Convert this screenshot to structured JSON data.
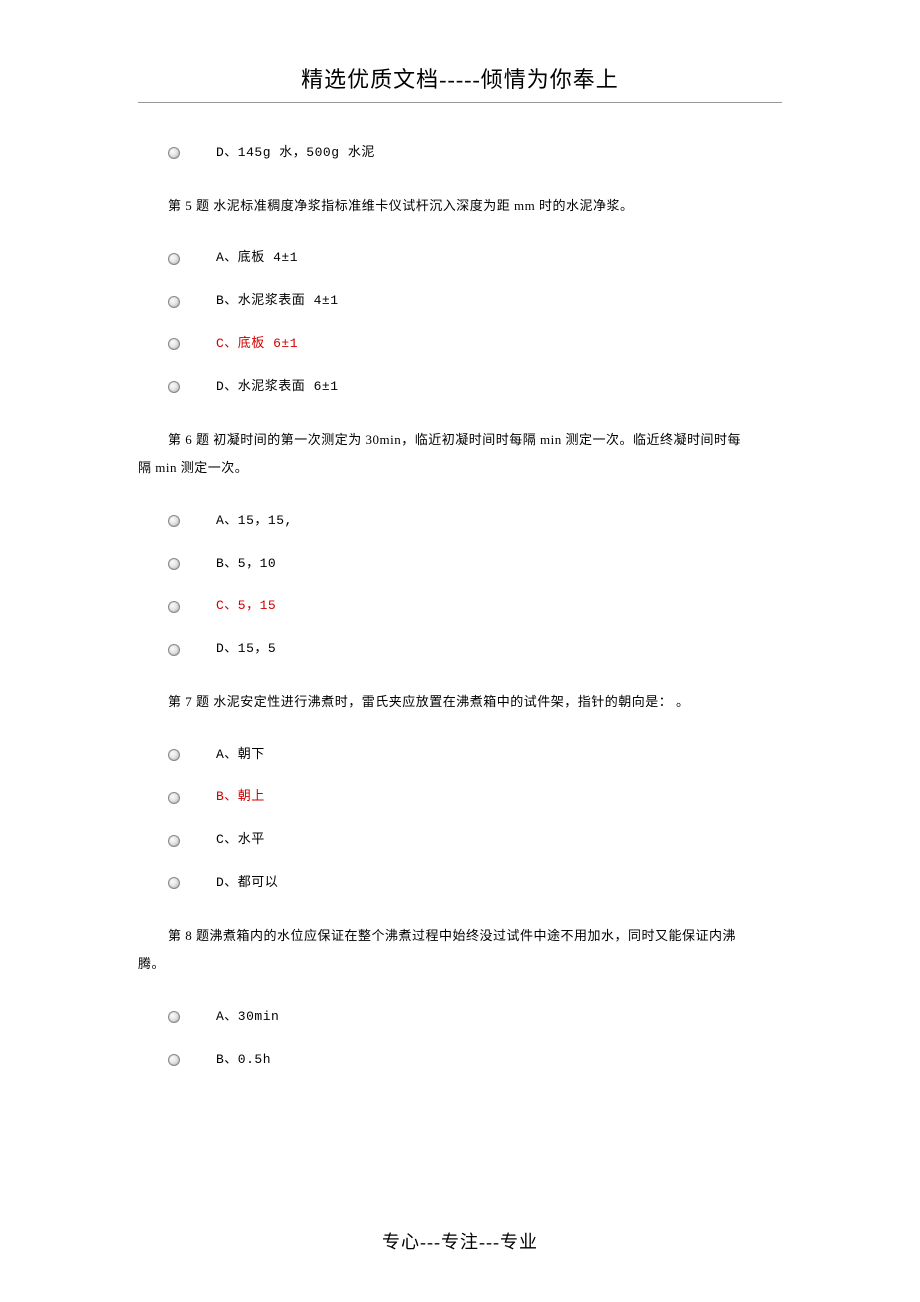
{
  "header": {
    "title": "精选优质文档-----倾情为你奉上"
  },
  "footer": {
    "text": "专心---专注---专业"
  },
  "orphan_option": {
    "text": "D、145g 水，500g 水泥",
    "highlighted": false
  },
  "questions": [
    {
      "label": "第 5 题",
      "text": "第 5 题 水泥标准稠度净浆指标准维卡仪试杆沉入深度为距 mm 时的水泥净浆。",
      "options": [
        {
          "text": "A、底板 4±1",
          "highlighted": false
        },
        {
          "text": "B、水泥浆表面 4±1",
          "highlighted": false
        },
        {
          "text": "C、底板 6±1",
          "highlighted": true
        },
        {
          "text": "D、水泥浆表面 6±1",
          "highlighted": false
        }
      ]
    },
    {
      "label": "第 6 题",
      "text_line1": "第 6 题 初凝时间的第一次测定为 30min，临近初凝时间时每隔 min 测定一次。临近终凝时间时每",
      "text_line2": "隔 min 测定一次。",
      "options": [
        {
          "text": "A、15，15,",
          "highlighted": false
        },
        {
          "text": "B、5，10",
          "highlighted": false
        },
        {
          "text": "C、5，15",
          "highlighted": true
        },
        {
          "text": "D、15，5",
          "highlighted": false
        }
      ]
    },
    {
      "label": "第 7 题",
      "text": "第 7 题 水泥安定性进行沸煮时，雷氏夹应放置在沸煮箱中的试件架，指针的朝向是： 。",
      "options": [
        {
          "text": "A、朝下",
          "highlighted": false
        },
        {
          "text": "B、朝上",
          "highlighted": true
        },
        {
          "text": "C、水平",
          "highlighted": false
        },
        {
          "text": "D、都可以",
          "highlighted": false
        }
      ]
    },
    {
      "label": "第 8 题",
      "text_line1": "第 8 题沸煮箱内的水位应保证在整个沸煮过程中始终没过试件中途不用加水，同时又能保证内沸",
      "text_line2": "腾。",
      "options": [
        {
          "text": "A、30min",
          "highlighted": false
        },
        {
          "text": "B、0.5h",
          "highlighted": false
        }
      ]
    }
  ]
}
